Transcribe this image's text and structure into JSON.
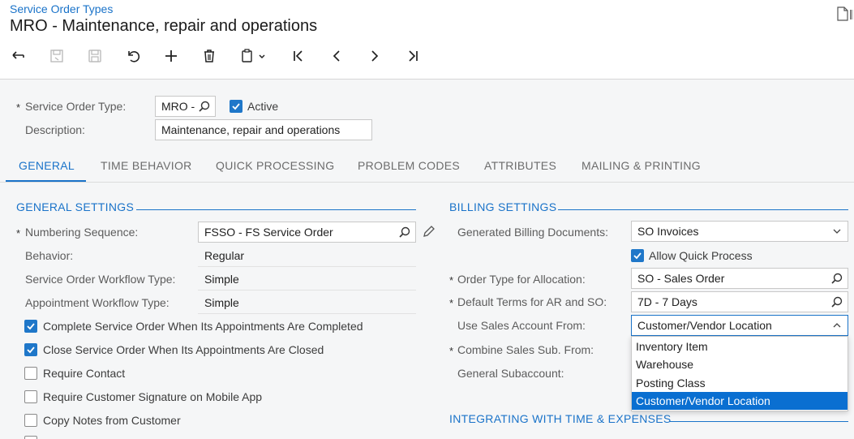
{
  "header": {
    "breadcrumb": "Service Order Types",
    "title": "MRO - Maintenance, repair and operations"
  },
  "toolbar": [
    "back",
    "save-close",
    "save",
    "cancel",
    "add",
    "delete",
    "copy-paste",
    "first",
    "previous",
    "next",
    "last"
  ],
  "form": {
    "service_order_type_label": "Service Order Type:",
    "service_order_type_value": "MRO -",
    "active_label": "Active",
    "active_checked": true,
    "description_label": "Description:",
    "description_value": "Maintenance, repair and operations"
  },
  "tabs": [
    "GENERAL",
    "TIME BEHAVIOR",
    "QUICK PROCESSING",
    "PROBLEM CODES",
    "ATTRIBUTES",
    "MAILING & PRINTING"
  ],
  "active_tab": "GENERAL",
  "general": {
    "title": "GENERAL SETTINGS",
    "numbering_label": "Numbering Sequence:",
    "numbering_value": "FSSO - FS Service Order",
    "behavior_label": "Behavior:",
    "behavior_value": "Regular",
    "so_workflow_label": "Service Order Workflow Type:",
    "so_workflow_value": "Simple",
    "appt_workflow_label": "Appointment Workflow Type:",
    "appt_workflow_value": "Simple",
    "checkboxes": [
      {
        "label": "Complete Service Order When Its Appointments Are Completed",
        "checked": true
      },
      {
        "label": "Close Service Order When Its Appointments Are Closed",
        "checked": true
      },
      {
        "label": "Require Contact",
        "checked": false
      },
      {
        "label": "Require Customer Signature on Mobile App",
        "checked": false
      },
      {
        "label": "Copy Notes from Customer",
        "checked": false
      }
    ]
  },
  "billing": {
    "title": "BILLING SETTINGS",
    "gen_docs_label": "Generated Billing Documents:",
    "gen_docs_value": "SO Invoices",
    "allow_quick_label": "Allow Quick Process",
    "allow_quick_checked": true,
    "order_type_label": "Order Type for Allocation:",
    "order_type_value": "SO - Sales Order",
    "default_terms_label": "Default Terms for AR and SO:",
    "default_terms_value": "7D - 7 Days",
    "sales_account_label": "Use Sales Account From:",
    "sales_account_value": "Customer/Vendor Location",
    "combine_label": "Combine Sales Sub. From:",
    "general_sub_label": "General Subaccount:",
    "dropdown_options": [
      "Inventory Item",
      "Warehouse",
      "Posting Class",
      "Customer/Vendor Location"
    ],
    "dropdown_selected": "Customer/Vendor Location"
  },
  "integrating": {
    "title": "INTEGRATING WITH TIME & EXPENSES"
  },
  "colors": {
    "accent": "#1a73c9",
    "selected_bg": "#0a6fd1",
    "panel_bg": "#f5f6f7"
  }
}
